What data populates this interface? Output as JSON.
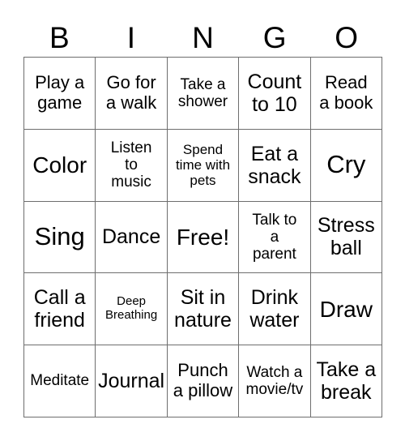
{
  "card": {
    "title_letters": [
      "B",
      "I",
      "N",
      "G",
      "O"
    ],
    "colors": {
      "background": "#ffffff",
      "text": "#000000",
      "grid_line": "#6e6e6e"
    },
    "grid_size": "5x5",
    "rows": [
      [
        {
          "text": "Play a\ngame",
          "size": "lg"
        },
        {
          "text": "Go for\na walk",
          "size": "lg"
        },
        {
          "text": "Take a\nshower",
          "size": "md"
        },
        {
          "text": "Count\nto 10",
          "size": "xl"
        },
        {
          "text": "Read\na book",
          "size": "lg"
        }
      ],
      [
        {
          "text": "Color",
          "size": "xxl"
        },
        {
          "text": "Listen\nto\nmusic",
          "size": "md"
        },
        {
          "text": "Spend\ntime with\npets",
          "size": "sm"
        },
        {
          "text": "Eat a\nsnack",
          "size": "xl"
        },
        {
          "text": "Cry",
          "size": "huge"
        }
      ],
      [
        {
          "text": "Sing",
          "size": "huge"
        },
        {
          "text": "Dance",
          "size": "xl"
        },
        {
          "text": "Free!",
          "size": "xxl"
        },
        {
          "text": "Talk to\na\nparent",
          "size": "md"
        },
        {
          "text": "Stress\nball",
          "size": "xl"
        }
      ],
      [
        {
          "text": "Call a\nfriend",
          "size": "xl"
        },
        {
          "text": "Deep\nBreathing",
          "size": "xs"
        },
        {
          "text": "Sit in\nnature",
          "size": "xl"
        },
        {
          "text": "Drink\nwater",
          "size": "xl"
        },
        {
          "text": "Draw",
          "size": "xxl"
        }
      ],
      [
        {
          "text": "Meditate",
          "size": "md"
        },
        {
          "text": "Journal",
          "size": "xl"
        },
        {
          "text": "Punch\na pillow",
          "size": "lg"
        },
        {
          "text": "Watch a\nmovie/tv",
          "size": "md"
        },
        {
          "text": "Take a\nbreak",
          "size": "xl"
        }
      ]
    ]
  }
}
